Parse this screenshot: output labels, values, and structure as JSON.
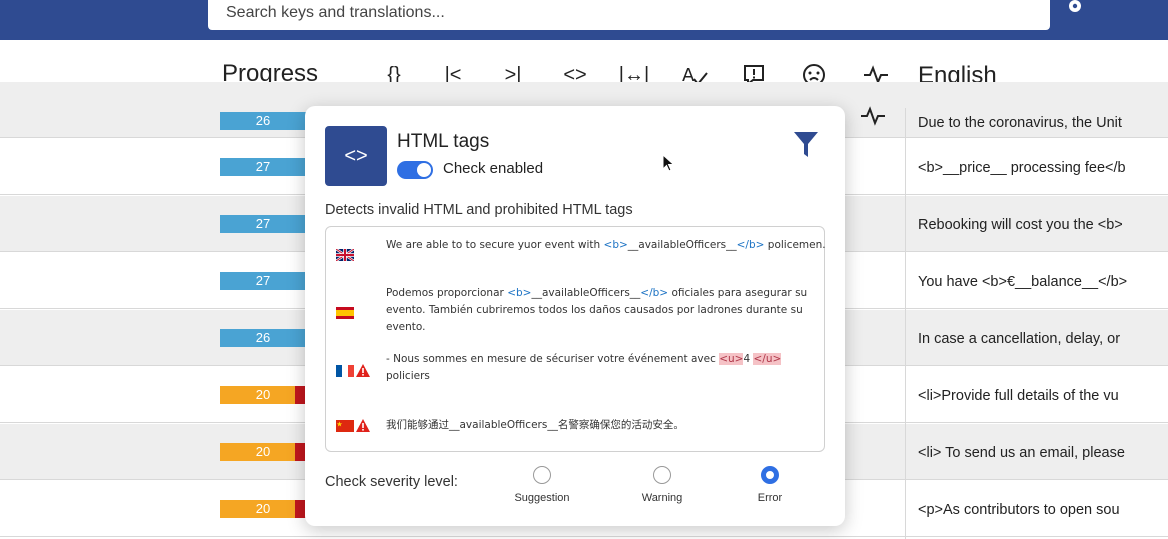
{
  "header": {
    "search_placeholder": "Search keys and translations..."
  },
  "columns": {
    "progress": "Progress",
    "english": "English"
  },
  "toolbar": {
    "items": [
      {
        "icon": "braces-icon",
        "glyph": "{}"
      },
      {
        "icon": "first-icon",
        "glyph": "I<"
      },
      {
        "icon": "last-icon",
        "glyph": ">I"
      },
      {
        "icon": "html-tags-icon",
        "glyph": "<>"
      },
      {
        "icon": "width-icon",
        "glyph": "|↔|"
      },
      {
        "icon": "spellcheck-icon",
        "glyph": "A✓"
      },
      {
        "icon": "comment-alert-icon",
        "glyph": "!"
      },
      {
        "icon": "emoji-icon",
        "glyph": "☹"
      },
      {
        "icon": "pulse-icon",
        "glyph": "-∿-"
      }
    ]
  },
  "rows": [
    {
      "progress": "26",
      "progress_type": "blue",
      "english": "Due to the coronavirus, the Unit"
    },
    {
      "progress": "27",
      "progress_type": "blue",
      "english": "<b>__price__ processing fee</b"
    },
    {
      "progress": "27",
      "progress_type": "blue",
      "english": "Rebooking will cost you the <b>"
    },
    {
      "progress": "27",
      "progress_type": "blue",
      "english": "You have <b>€__balance__</b>"
    },
    {
      "progress": "26",
      "progress_type": "blue",
      "english": "In case a cancellation, delay, or"
    },
    {
      "progress": "20",
      "progress_type": "orange",
      "english": "<li>Provide full details of the vu"
    },
    {
      "progress": "20",
      "progress_type": "orange",
      "english": "<li> To send us an email, please"
    },
    {
      "progress": "20",
      "progress_type": "orange",
      "english": "<p>As contributors to open sou"
    }
  ],
  "popup": {
    "icon_glyph": "<>",
    "title": "HTML tags",
    "toggle_label": "Check enabled",
    "description": "Detects invalid HTML and prohibited HTML tags",
    "samples": [
      {
        "flag": "uk-flag-icon",
        "warn": false,
        "text_before": "We are able to to secure yuor event with ",
        "tag_open": "<b>",
        "mid": "__availableOfficers__",
        "tag_close": "</b>",
        "text_after": " policemen."
      },
      {
        "flag": "spain-flag-icon",
        "warn": false,
        "text_before": "Podemos proporcionar ",
        "tag_open": "<b>",
        "mid": "__availableOfficers__",
        "tag_close": "</b>",
        "text_after": " oficiales para asegurar su evento. También cubriremos todos los daños causados por ladrones durante su evento."
      },
      {
        "flag": "france-flag-icon",
        "warn": true,
        "text_before": "- Nous sommes en mesure de sécuriser votre événement avec ",
        "tag_open": "<u>",
        "mid": "4",
        "tag_close": "</u>",
        "text_after": " policiers"
      },
      {
        "flag": "china-flag-icon",
        "warn": true,
        "text_before": "我们能够通过__availableOfficers__名警察确保您的活动安全。",
        "tag_open": "",
        "mid": "",
        "tag_close": "",
        "text_after": ""
      }
    ],
    "severity_label": "Check severity level:",
    "severity_options": [
      {
        "label": "Suggestion",
        "selected": false
      },
      {
        "label": "Warning",
        "selected": false
      },
      {
        "label": "Error",
        "selected": true
      }
    ]
  },
  "colors": {
    "brand": "#2f4b91",
    "accent": "#2f6fe3",
    "progress_blue": "#4aa3d3",
    "progress_orange": "#f5a623",
    "progress_red": "#c0161d",
    "tag_blue": "#1d73c4",
    "tag_error_bg": "#f5c2c6"
  }
}
